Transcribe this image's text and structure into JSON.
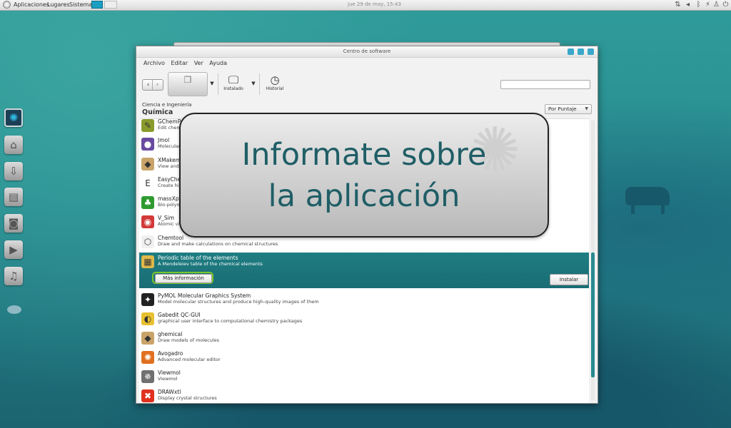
{
  "top_panel": {
    "menus": [
      "Aplicaciones",
      "Lugares",
      "Sistema"
    ],
    "clock": "jue 29 de may, 15:43",
    "tray_icons": [
      "network-icon",
      "volume-icon",
      "bluetooth-icon",
      "power-cord-icon",
      "user-icon",
      "shutdown-icon"
    ]
  },
  "dock": [
    "monitor-icon",
    "home-folder-icon",
    "downloads-folder-icon",
    "documents-folder-icon",
    "pictures-folder-icon",
    "videos-folder-icon",
    "music-folder-icon",
    "disc-icon"
  ],
  "window": {
    "title": "Centro de software",
    "menubar": [
      "Archivo",
      "Editar",
      "Ver",
      "Ayuda"
    ],
    "toolbar": {
      "installed_label": "Instalado",
      "history_label": "Historial"
    },
    "search": {
      "value": "",
      "placeholder": ""
    },
    "breadcrumb_parent": "Ciencia e Ingeniería",
    "page_title": "Química",
    "sort": {
      "selected": "Por Puntaje"
    },
    "apps": [
      {
        "name": "GChemPaint",
        "desc": "Edit chemical structures",
        "icon": "gchempaint-icon",
        "color": "#8a9a2c",
        "glyph": "✎"
      },
      {
        "name": "Jmol",
        "desc": "Molecular viewer",
        "icon": "jmol-icon",
        "color": "#6a4aa0",
        "glyph": "●"
      },
      {
        "name": "XMakemol",
        "desc": "View and animate molecules",
        "icon": "xmakemol-icon",
        "color": "#c9a46a",
        "glyph": "◆"
      },
      {
        "name": "EasyChem",
        "desc": "Create high-quality chemical drawings",
        "icon": "easychem-icon",
        "color": "#ffffff",
        "glyph": "E"
      },
      {
        "name": "massXpert",
        "desc": "Bio-polymer mass spectrometry",
        "icon": "massxpert-icon",
        "color": "#2f9a2f",
        "glyph": "♣"
      },
      {
        "name": "V_Sim",
        "desc": "Atomic visualisation",
        "icon": "vsim-icon",
        "color": "#d23a3a",
        "glyph": "◉"
      },
      {
        "name": "Chemtool",
        "desc": "Draw and make calculations on chemical structures",
        "icon": "chemtool-icon",
        "color": "#f0f0f0",
        "glyph": "⬡"
      },
      {
        "name": "Periodic table of the elements",
        "desc": "A Mendeleiev table of the chemical elements",
        "icon": "periodic-table-icon",
        "color": "#e0b84a",
        "glyph": "▦"
      },
      {
        "name": "PyMOL Molecular Graphics System",
        "desc": "Model molecular structures and produce high-quality images of them",
        "icon": "pymol-icon",
        "color": "#222222",
        "glyph": "✦"
      },
      {
        "name": "Gabedit QC-GUI",
        "desc": "graphical user interface to computational chemistry packages",
        "icon": "gabedit-icon",
        "color": "#e8c030",
        "glyph": "◐"
      },
      {
        "name": "ghemical",
        "desc": "Draw models of molecules",
        "icon": "ghemical-icon",
        "color": "#c9a46a",
        "glyph": "◆"
      },
      {
        "name": "Avogadro",
        "desc": "Advanced molecular editor",
        "icon": "avogadro-icon",
        "color": "#e07020",
        "glyph": "✺"
      },
      {
        "name": "Viewmol",
        "desc": "Viewmol",
        "icon": "viewmol-icon",
        "color": "#707070",
        "glyph": "✵"
      },
      {
        "name": "DRAWxtl",
        "desc": "Display crystal structures",
        "icon": "drawxtl-icon",
        "color": "#e03020",
        "glyph": "✖"
      }
    ],
    "more_info_label": "Más información",
    "install_label": "Instalar"
  },
  "overlay": {
    "line1": "Informate sobre",
    "line2": "la aplicación"
  }
}
